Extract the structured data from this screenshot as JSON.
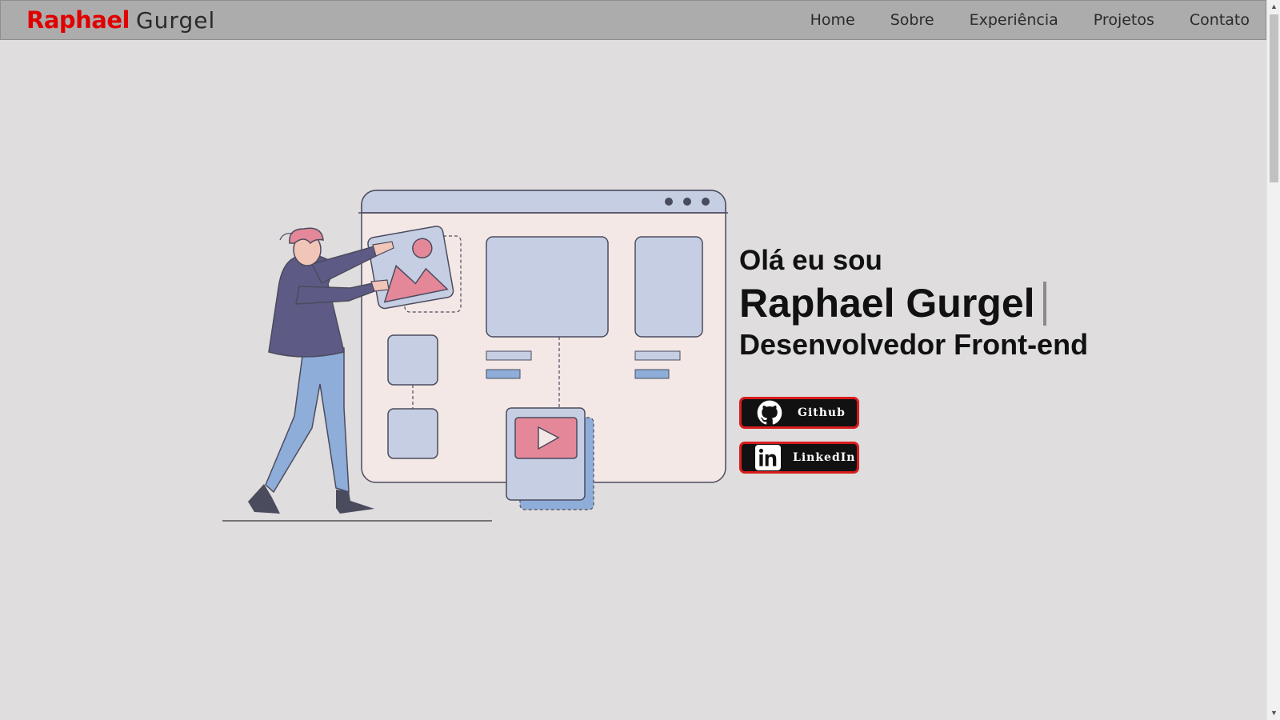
{
  "header": {
    "brand_first": "Raphael",
    "brand_last": "Gurgel",
    "nav": [
      "Home",
      "Sobre",
      "Experiência",
      "Projetos",
      "Contato"
    ]
  },
  "hero": {
    "greeting": "Olá eu sou",
    "name": "Raphael Gurgel",
    "role": "Desenvolvedor Front-end"
  },
  "buttons": {
    "github": "Github",
    "linkedin": "LinkedIn"
  },
  "colors": {
    "accent": "#e00000",
    "navbar": "#acacac",
    "background": "#dfdddd",
    "button_bg": "#111111",
    "button_border": "#d81c1c"
  },
  "icons": {
    "github": "github-icon",
    "linkedin": "linkedin-icon"
  }
}
